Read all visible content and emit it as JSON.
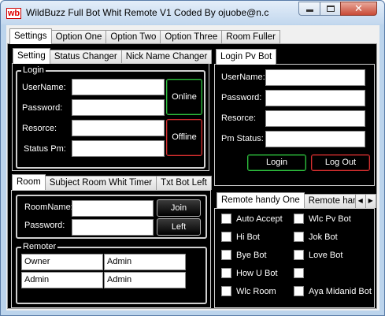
{
  "window": {
    "logo_text": "wb",
    "title": "WildBuzz Full Bot Whit  Remote V1 Coded By ojuobe@n.c",
    "close_glyph": "✕"
  },
  "main_tabs": [
    "Settings",
    "Option One",
    "Option Two",
    "Option Three",
    "Room Fuller"
  ],
  "settings_tabs": [
    "Setting",
    "Status Changer",
    "Nick Name Changer"
  ],
  "login": {
    "group_title": "Login",
    "username_label": "UserName:",
    "password_label": "Password:",
    "resource_label": "Resorce:",
    "status_pm_label": "Status Pm:",
    "online_button": "Online",
    "offline_button": "Offline"
  },
  "login_pv": {
    "tab": "Login Pv Bot",
    "username_label": "UserName:",
    "password_label": "Password:",
    "resource_label": "Resorce:",
    "pm_status_label": "Pm Status:",
    "login_button": "Login",
    "logout_button": "Log Out"
  },
  "room_tabs": [
    "Room",
    "Subject Room Whit Timer",
    "Txt Bot Left"
  ],
  "room": {
    "roomname_label": "RoomName:",
    "password_label": "Password:",
    "join_button": "Join",
    "left_button": "Left"
  },
  "remoter": {
    "group_title": "Remoter",
    "rows": [
      [
        "Owner",
        "Admin"
      ],
      [
        "Admin",
        "Admin"
      ]
    ]
  },
  "remote_tabs": [
    "Remote handy One",
    "Remote hand"
  ],
  "remote_scroll": {
    "left": "◀",
    "right": "▶"
  },
  "remote_checkboxes": {
    "left": [
      "Auto Accept",
      "Hi Bot",
      "Bye Bot",
      "How U Bot",
      "Wlc Room"
    ],
    "right": [
      "Wlc Pv Bot",
      "Jok Bot",
      "Love Bot",
      "",
      "Aya Midanid Bot"
    ]
  }
}
